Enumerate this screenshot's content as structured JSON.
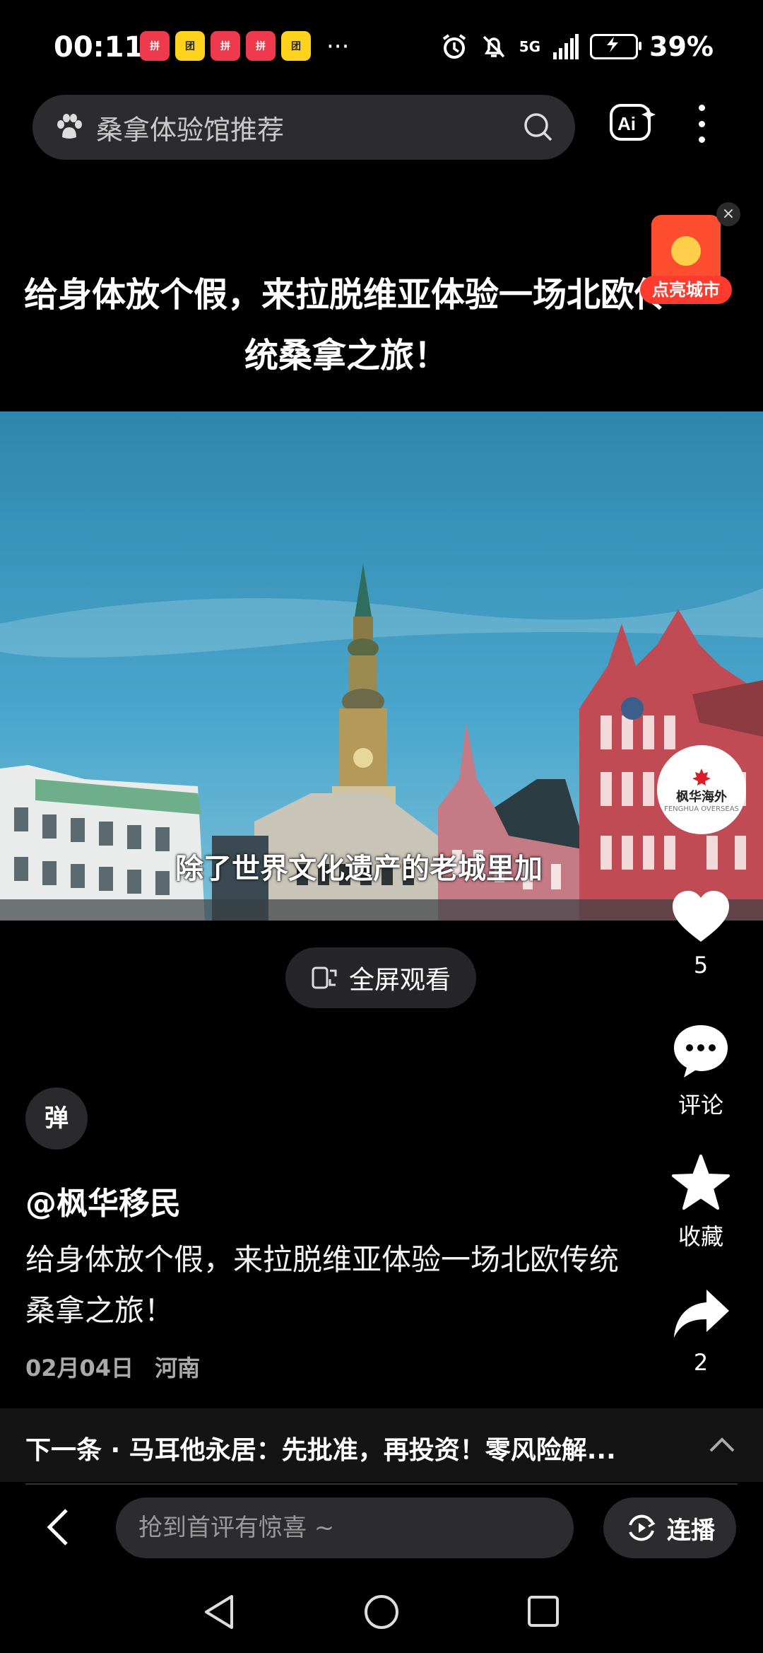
{
  "status_bar": {
    "time": "00:11",
    "apps": [
      {
        "icon": "pinduoduo-icon",
        "label": "拼"
      },
      {
        "icon": "meituan-icon",
        "label": "团"
      },
      {
        "icon": "pinduoduo-icon",
        "label": "拼"
      },
      {
        "icon": "pinduoduo-icon",
        "label": "拼"
      },
      {
        "icon": "meituan-icon",
        "label": "团"
      }
    ],
    "more": "···",
    "network": "5G",
    "battery": "39%"
  },
  "search": {
    "query": "桑拿体验馆推荐"
  },
  "video": {
    "title": "给身体放个假，来拉脱维亚体验一场北欧传统桑拿之旅！",
    "subtitle": "除了世界文化遗产的老城里加",
    "fullscreen_label": "全屏观看"
  },
  "promo": {
    "label": "点亮城市",
    "close": "×"
  },
  "channel": {
    "avatar_name": "枫华海外",
    "avatar_tagline": "FENGHUA OVERSEAS"
  },
  "actions": {
    "likes": "5",
    "comment_label": "评论",
    "collect_label": "收藏",
    "shares": "2"
  },
  "post": {
    "danmu_label": "弹",
    "author": "@枫华移民",
    "description": "给身体放个假，来拉脱维亚体验一场北欧传统桑拿之旅！",
    "date": "02月04日",
    "location": "河南"
  },
  "next": {
    "text": "下一条 · 马耳他永居：先批准，再投资！零风险解..."
  },
  "comment_bar": {
    "placeholder": "抢到首评有惊喜 ~",
    "autoplay_label": "连播"
  },
  "colors": {
    "accent_red": "#ef3a4d",
    "background": "#000000",
    "surface": "#2c2c2e"
  }
}
